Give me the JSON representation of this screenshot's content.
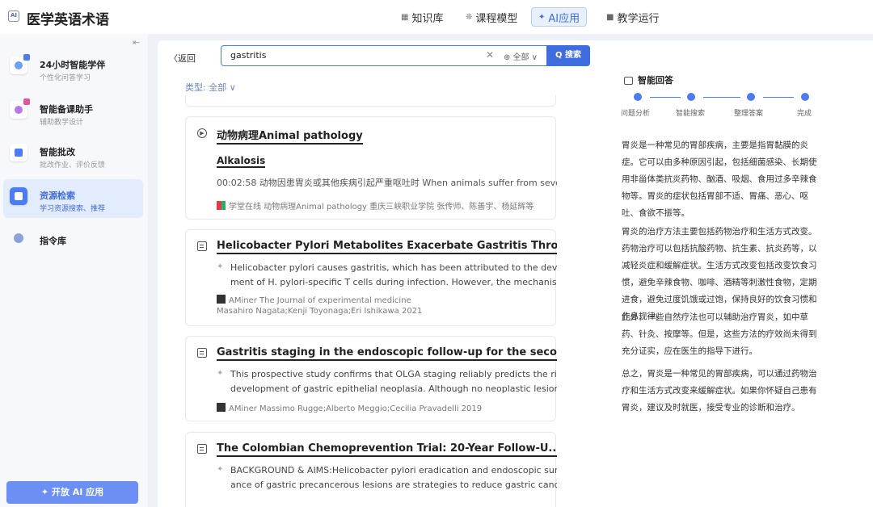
{
  "header": {
    "logo_text": "AI",
    "app_title": "医学英语术语",
    "nav": [
      {
        "icon": "book-icon",
        "glyph": "▦",
        "label": "知识库"
      },
      {
        "icon": "model-icon",
        "glyph": "❊",
        "label": "课程模型"
      },
      {
        "icon": "ai-sparkle-icon",
        "glyph": "✦",
        "label": "AI应用"
      },
      {
        "icon": "grid-icon",
        "glyph": "■",
        "label": "教学运行"
      }
    ]
  },
  "sidebar": {
    "items": [
      {
        "title": "24小时智能学伴",
        "subtitle": "个性化问答学习",
        "icon": "companion-icon"
      },
      {
        "title": "智能备课助手",
        "subtitle": "辅助教学设计",
        "icon": "lesson-prep-icon"
      },
      {
        "title": "智能批改",
        "subtitle": "批改作业、评价反馈",
        "icon": "grading-icon"
      },
      {
        "title": "资源检索",
        "subtitle": "学习资源搜索、推荐",
        "icon": "resource-search-icon"
      },
      {
        "title": "指令库",
        "subtitle": "",
        "icon": "prompt-library-icon"
      }
    ],
    "open_ai_button": "✦ 开放 AI 应用"
  },
  "search": {
    "back": "〈返回",
    "query": "gastritis",
    "clear": "✕",
    "scope": "⊕ 全部 ∨",
    "button": "Q 搜索",
    "filter": "类型: 全部 ∨"
  },
  "results": [
    {
      "type": "video",
      "title": "动物病理Animal pathology",
      "subtitle": "Alkalosis",
      "snippet": "00:02:58  动物因患胃炎或其他疾病引起严重呕吐时 When animals suffer from sever...",
      "source": "学堂在线    动物病理Animal pathology    重庆三峡职业学院    张传师、陈善宇、杨延辉等"
    },
    {
      "type": "paper",
      "title": "Helicobacter Pylori Metabolites Exacerbate Gastritis Thro...",
      "abstract": [
        "Helicobacter pylori causes gastritis, which has been attributed to the develop",
        "ment of H. pylori-specific T cells during infection. However, the mechanism u..."
      ],
      "source": "AMiner    The Journal of experimental medicine",
      "authors": "Masahiro Nagata;Kenji Toyonaga;Eri Ishikawa    2021"
    },
    {
      "type": "paper",
      "title": "Gastritis staging in the endoscopic follow-up for the seco...",
      "abstract": [
        "This prospective study confirms that OLGA staging reliably predicts the risk for",
        "development of gastric epithelial neoplasia. Although no neoplastic lesions a..."
      ],
      "source": "AMiner    Massimo Rugge;Alberto Meggio;Cecilia Pravadelli    2019"
    },
    {
      "type": "paper",
      "title": "The Colombian Chemoprevention Trial: 20-Year Follow-U...",
      "abstract": [
        "BACKGROUND & AIMS:Helicobacter pylori eradication and endoscopic surveill",
        "ance of gastric precancerous lesions are strategies to reduce gastric cancer (..."
      ]
    }
  ],
  "answer": {
    "heading": "智能回答",
    "steps": [
      "问题分析",
      "智能搜索",
      "整理答案",
      "完成"
    ],
    "paragraphs": [
      "胃炎是一种常见的胃部疾病，主要是指胃黏膜的炎症。它可以由多种原因引起，包括细菌感染、长期使用非甾体类抗炎药物、酗酒、吸烟、食用过多辛辣食物等。胃炎的症状包括胃部不适、胃痛、恶心、呕吐、食欲不振等。",
      "胃炎的治疗方法主要包括药物治疗和生活方式改变。药物治疗可以包括抗酸药物、抗生素、抗炎药等，以减轻炎症和缓解症状。生活方式改变包括改变饮食习惯，避免辛辣食物、咖啡、酒精等刺激性食物，定期进食，避免过度饥饿或过饱，保持良好的饮食习惯和作息规律。",
      "此外，一些自然疗法也可以辅助治疗胃炎，如中草药、针灸、按摩等。但是，这些方法的疗效尚未得到充分证实，应在医生的指导下进行。",
      "总之，胃炎是一种常见的胃部疾病，可以通过药物治疗和生活方式改变来缓解症状。如果你怀疑自己患有胃炎，建议及时就医，接受专业的诊断和治疗。"
    ]
  }
}
